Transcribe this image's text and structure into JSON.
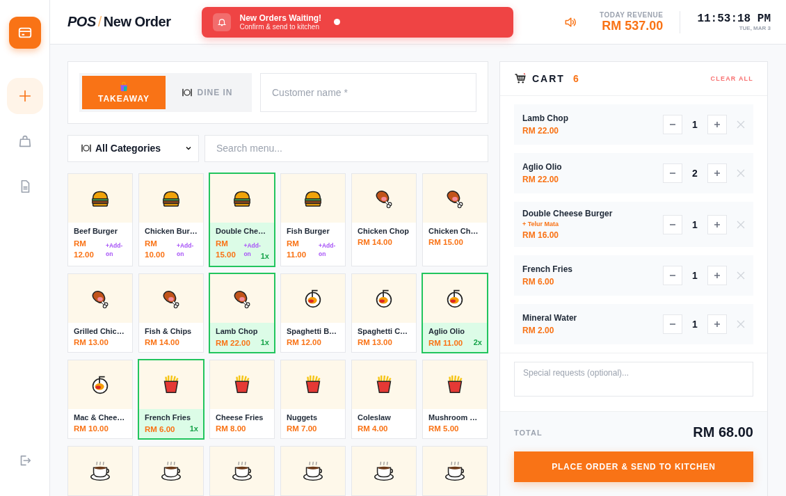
{
  "header": {
    "brand": "POS",
    "separator": "/",
    "page_title": "New Order",
    "alert": {
      "title": "New Orders Waiting!",
      "subtitle": "Confirm & send to kitchen"
    },
    "revenue": {
      "label": "TODAY REVENUE",
      "value": "RM 537.00"
    },
    "clock": {
      "time": "11:53:18 PM",
      "date": "TUE, MAR 3"
    }
  },
  "sidebar": {
    "items": [
      {
        "kind": "new",
        "selected": true
      },
      {
        "kind": "orders",
        "selected": false
      },
      {
        "kind": "reports",
        "selected": false
      }
    ]
  },
  "order_types": [
    {
      "kind": "takeaway",
      "label": "TAKEAWAY",
      "selected": true
    },
    {
      "kind": "dine_in",
      "label": "DINE IN",
      "selected": false
    }
  ],
  "customer_field": {
    "placeholder": "Customer name *"
  },
  "category_select": {
    "value": "All Categories"
  },
  "menu_search": {
    "placeholder": "Search menu..."
  },
  "menu_items": [
    {
      "kind": "burger",
      "name": "Beef Burger",
      "price": "RM 12.00",
      "addon": "+Add-on",
      "selected": false
    },
    {
      "kind": "burger",
      "name": "Chicken Bur…",
      "price": "RM 10.00",
      "addon": "+Add-on",
      "selected": false
    },
    {
      "kind": "burger",
      "name": "Double Che…",
      "price": "RM 15.00",
      "addon": "+Add-on",
      "count": "1x",
      "selected": true
    },
    {
      "kind": "burger",
      "name": "Fish Burger",
      "price": "RM 11.00",
      "addon": "+Add-on",
      "selected": false
    },
    {
      "kind": "meat",
      "name": "Chicken Chop",
      "price": "RM 14.00",
      "selected": false
    },
    {
      "kind": "meat",
      "name": "Chicken Ch…",
      "price": "RM 15.00",
      "selected": false
    },
    {
      "kind": "meat",
      "name": "Grilled Chic…",
      "price": "RM 13.00",
      "selected": false
    },
    {
      "kind": "meat",
      "name": "Fish & Chips",
      "price": "RM 14.00",
      "selected": false
    },
    {
      "kind": "meat",
      "name": "Lamb Chop",
      "price": "RM 22.00",
      "count": "1x",
      "selected": true
    },
    {
      "kind": "pasta",
      "name": "Spaghetti B…",
      "price": "RM 12.00",
      "selected": false
    },
    {
      "kind": "pasta",
      "name": "Spaghetti C…",
      "price": "RM 13.00",
      "selected": false
    },
    {
      "kind": "pasta",
      "name": "Aglio Olio",
      "price": "RM 11.00",
      "count": "2x",
      "selected": true
    },
    {
      "kind": "pasta",
      "name": "Mac & Chee…",
      "price": "RM 10.00",
      "selected": false
    },
    {
      "kind": "fries",
      "name": "French Fries",
      "price": "RM 6.00",
      "count": "1x",
      "selected": true
    },
    {
      "kind": "fries",
      "name": "Cheese Fries",
      "price": "RM 8.00",
      "selected": false
    },
    {
      "kind": "fries",
      "name": "Nuggets",
      "price": "RM 7.00",
      "selected": false
    },
    {
      "kind": "fries",
      "name": "Coleslaw",
      "price": "RM 4.00",
      "selected": false
    },
    {
      "kind": "fries",
      "name": "Mushroom …",
      "price": "RM 5.00",
      "selected": false
    },
    {
      "kind": "coffee",
      "selected": false
    },
    {
      "kind": "coffee",
      "selected": false
    },
    {
      "kind": "coffee",
      "selected": false
    },
    {
      "kind": "coffee",
      "selected": false
    },
    {
      "kind": "coffee",
      "selected": false
    },
    {
      "kind": "coffee",
      "selected": false
    }
  ],
  "cart": {
    "title": "CART",
    "count": "6",
    "clear_label": "CLEAR ALL",
    "items": [
      {
        "name": "Lamb Chop",
        "price": "RM 22.00",
        "qty": "1"
      },
      {
        "name": "Aglio Olio",
        "price": "RM 22.00",
        "qty": "2"
      },
      {
        "name": "Double Cheese Burger",
        "addon": "+ Telur Mata",
        "price": "RM 16.00",
        "qty": "1"
      },
      {
        "name": "French Fries",
        "price": "RM 6.00",
        "qty": "1"
      },
      {
        "name": "Mineral Water",
        "price": "RM 2.00",
        "qty": "1"
      }
    ],
    "notes": {
      "placeholder": "Special requests (optional)..."
    },
    "total_label": "TOTAL",
    "total": "RM 68.00",
    "submit": "PLACE ORDER & SEND TO KITCHEN"
  }
}
